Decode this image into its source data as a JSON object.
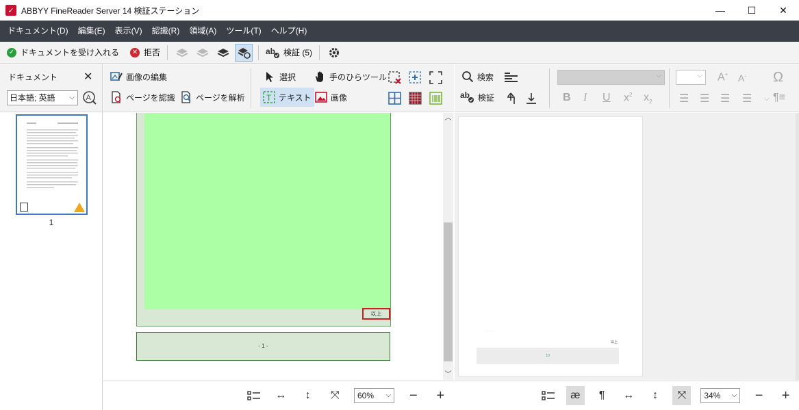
{
  "window": {
    "title": "ABBYY FineReader Server 14 検証ステーション",
    "minimize": "—",
    "maximize": "☐",
    "close": "✕"
  },
  "menu": [
    "ドキュメント(D)",
    "編集(E)",
    "表示(V)",
    "認識(R)",
    "領域(A)",
    "ツール(T)",
    "ヘルプ(H)"
  ],
  "toolbar": {
    "accept_label": "ドキュメントを受け入れる",
    "reject_label": "拒否",
    "verify_label": "検証 (5)"
  },
  "docpanel": {
    "title": "ドキュメント",
    "language": "日本語; 英語",
    "page_number": "1"
  },
  "imagepanel": {
    "edit_image": "画像の編集",
    "recognize_page": "ページを認識",
    "analyze_page": "ページを解析",
    "select": "選択",
    "hand_tool": "手のひらツール",
    "text": "テキスト",
    "image": "画像",
    "region_text_ijo": "以上",
    "region_footer": "- 1 -",
    "zoom": "60%"
  },
  "textpanel": {
    "search": "検索",
    "verify": "検証",
    "page_ijo": "以上",
    "page_footer": "10",
    "page_dots": "· · · ·",
    "zoom": "34%"
  },
  "colors": {
    "menubar": "#3b3f48",
    "accent_red": "#c8102e",
    "green_region": "#adffa6",
    "selection_red": "#d01f1f"
  }
}
